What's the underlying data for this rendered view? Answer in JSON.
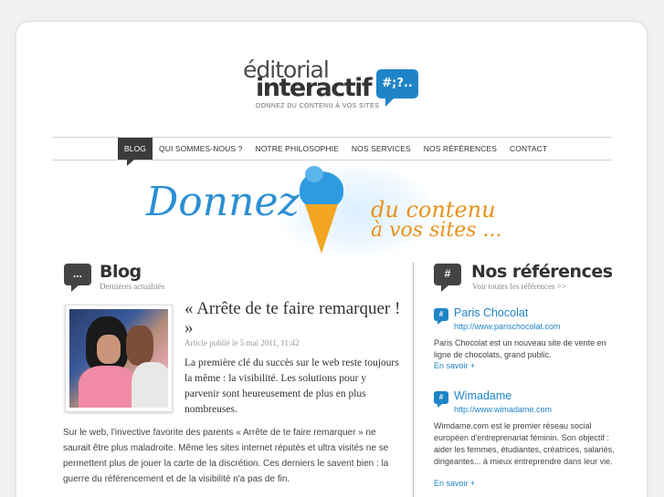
{
  "logo": {
    "line1": "éditorial",
    "line2": "interactif",
    "bubble": "#;?..",
    "tagline": "DONNEZ DU CONTENU À VOS SITES"
  },
  "nav": {
    "items": [
      {
        "label": "BLOG",
        "active": true
      },
      {
        "label": "QUI SOMMES-NOUS ?",
        "active": false
      },
      {
        "label": "NOTRE PHILOSOPHIE",
        "active": false
      },
      {
        "label": "NOS SERVICES",
        "active": false
      },
      {
        "label": "NOS RÉFÉRENCES",
        "active": false
      },
      {
        "label": "CONTACT",
        "active": false
      }
    ]
  },
  "banner": {
    "main": "Donnez",
    "sub1": "du contenu",
    "sub2": "à vos sites ..."
  },
  "blog": {
    "icon": "...",
    "title": "Blog",
    "subtitle": "Dernières actualités",
    "article": {
      "title": "« Arrête de te faire remarquer ! »",
      "meta": "Article publié le 5 mai 2011, 11:42",
      "lead": "La première clé du succès sur le web reste toujours la même : la visibilité. Les solutions pour y parvenir sont heureusement de plus en plus nombreuses.",
      "body": "Sur le web, l'invective favorite des parents « Arrête de te faire remarquer » ne saurait être plus maladroite. Même les sites internet réputés et ultra visités ne se permettent plus de jouer la carte de la discrétion. Ces derniers le savent bien : la guerre du référencement et de la visibilité n'a pas de fin."
    }
  },
  "references": {
    "icon": "#",
    "title": "Nos références",
    "subtitle": "Voir toutes les références >>",
    "items": [
      {
        "name": "Paris Chocolat",
        "url": "http://www.parischocolat.com",
        "desc": "Paris Chocolat est un nouveau site de vente en ligne de chocolats, grand public.",
        "more": "En savoir +"
      },
      {
        "name": "Wimadame",
        "url": "http://www.wimadame.com",
        "desc": "Wimdame.com est le premier réseau social européen d'entreprenariat féminin. Son objectif : aider les femmes, étudiantes, créatrices, salariés, dirigeantes... à mieux entreprendre dans leur vie.",
        "more": "En savoir +"
      }
    ]
  },
  "colors": {
    "accent": "#1f84c7",
    "banner_orange": "#e9911a",
    "nav_active": "#3b3b3b"
  }
}
